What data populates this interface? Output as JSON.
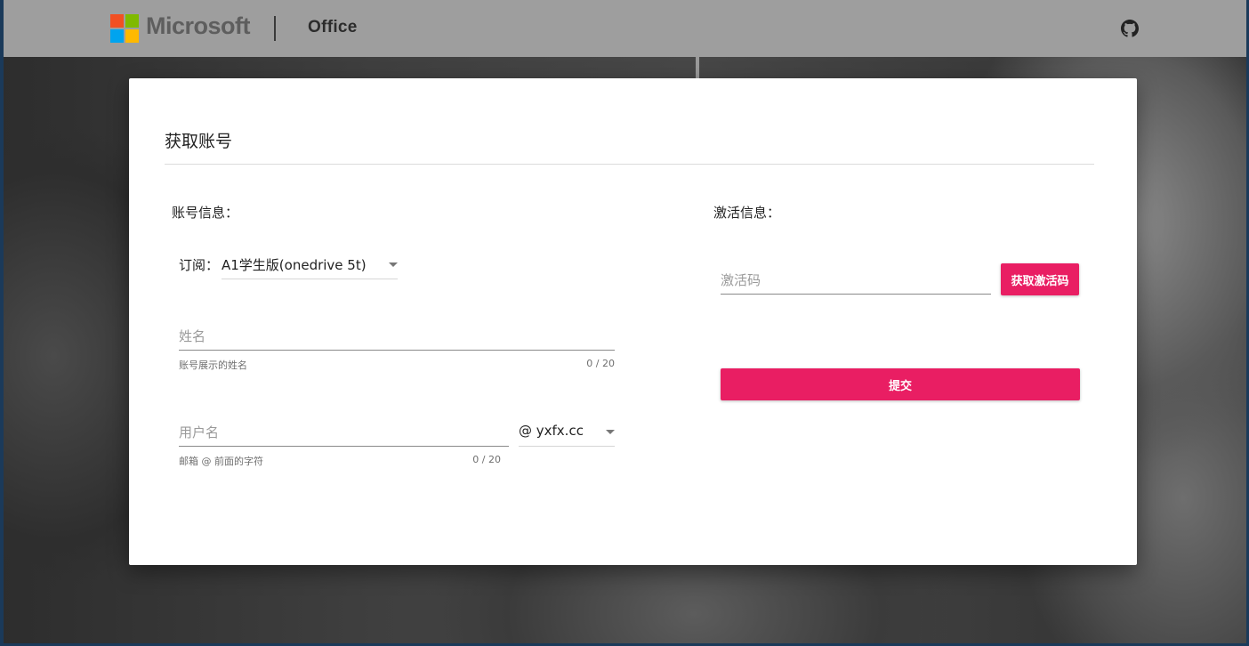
{
  "header": {
    "brand": "Microsoft",
    "product": "Office",
    "github_icon": "github-icon"
  },
  "colors": {
    "accent": "#e91e63",
    "header_bg": "#9e9e9e",
    "logo_red": "#f25022",
    "logo_green": "#7fba00",
    "logo_blue": "#00a4ef",
    "logo_yellow": "#ffb900"
  },
  "dialog": {
    "title": "获取账号",
    "account_section": {
      "title": "账号信息：",
      "subscription_label": "订阅：",
      "subscription_value": "A1学生版(onedrive 5t)",
      "name": {
        "placeholder": "姓名",
        "value": "",
        "hint": "账号展示的姓名",
        "counter": "0 / 20"
      },
      "username": {
        "placeholder": "用户名",
        "value": "",
        "hint": "邮箱 @ 前面的字符",
        "counter": "0 / 20"
      },
      "domain_value": "@ yxfx.cc"
    },
    "activation_section": {
      "title": "激活信息：",
      "code": {
        "placeholder": "激活码",
        "value": ""
      },
      "get_code_button": "获取激活码",
      "submit_button": "提交"
    }
  }
}
